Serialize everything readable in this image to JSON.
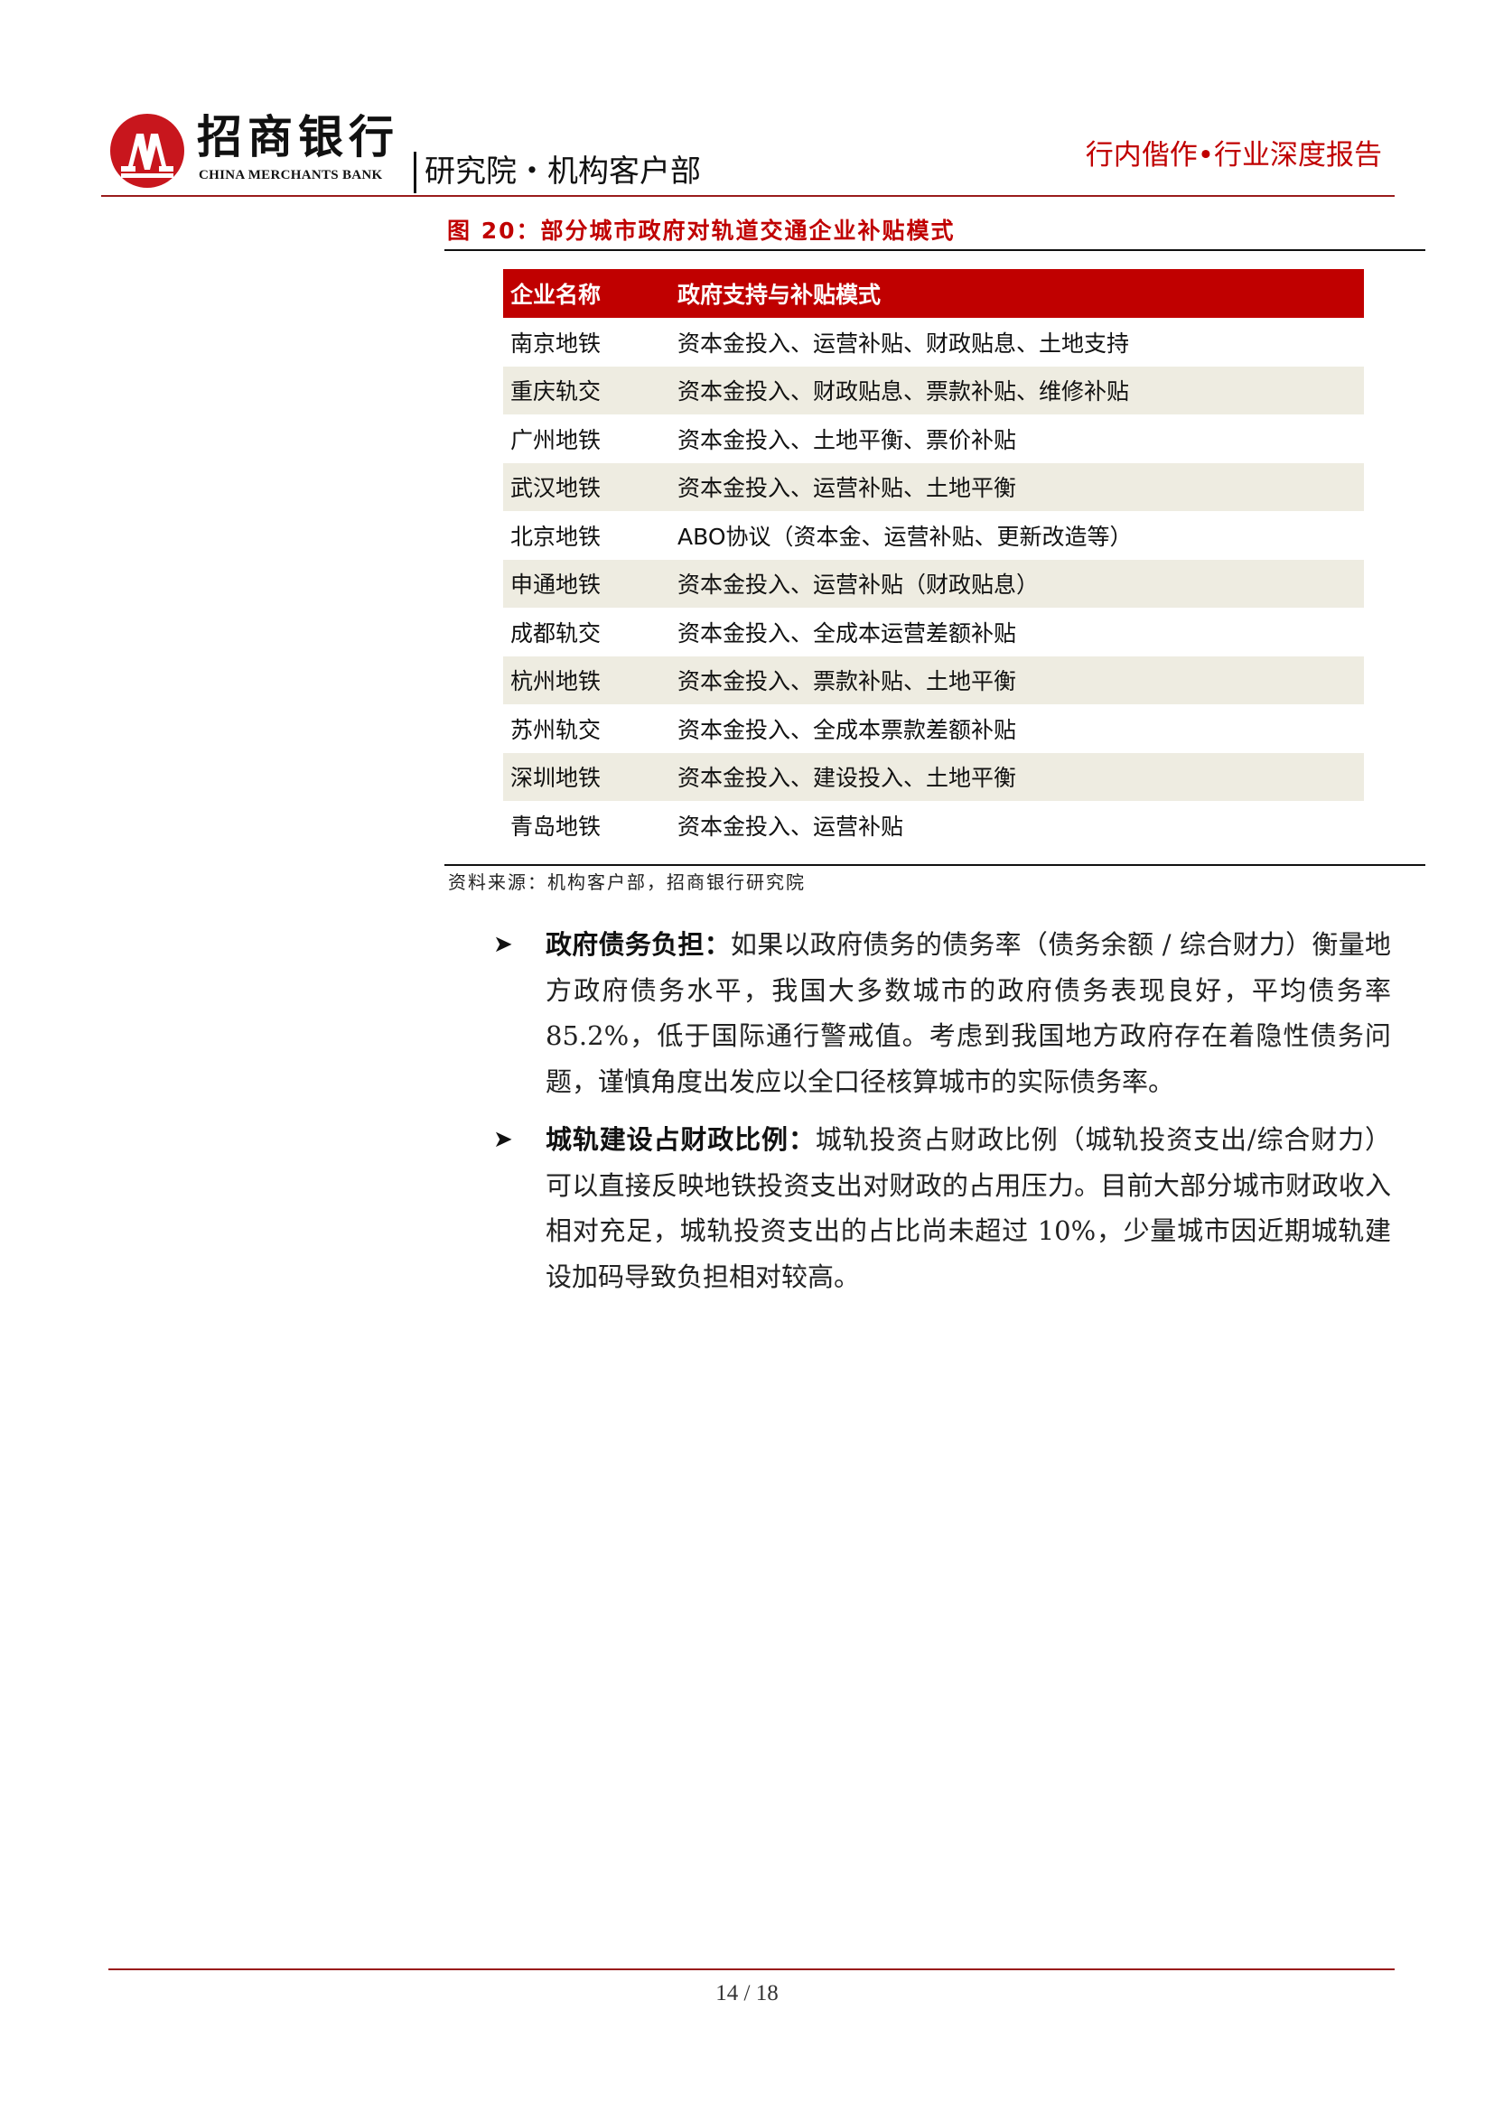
{
  "header": {
    "logo_cn": "招商银行",
    "logo_en": "CHINA MERCHANTS BANK",
    "department": "研究院・机构客户部",
    "report_type": "行内偕作•行业深度报告",
    "brand_color": "#c00000"
  },
  "figure": {
    "title": "图 20：部分城市政府对轨道交通企业补贴模式",
    "columns": [
      "企业名称",
      "政府支持与补贴模式"
    ],
    "rows": [
      [
        "南京地铁",
        "资本金投入、运营补贴、财政贴息、土地支持"
      ],
      [
        "重庆轨交",
        "资本金投入、财政贴息、票款补贴、维修补贴"
      ],
      [
        "广州地铁",
        "资本金投入、土地平衡、票价补贴"
      ],
      [
        "武汉地铁",
        "资本金投入、运营补贴、土地平衡"
      ],
      [
        "北京地铁",
        "ABO协议（资本金、运营补贴、更新改造等）"
      ],
      [
        "申通地铁",
        "资本金投入、运营补贴（财政贴息）"
      ],
      [
        "成都轨交",
        "资本金投入、全成本运营差额补贴"
      ],
      [
        "杭州地铁",
        "资本金投入、票款补贴、土地平衡"
      ],
      [
        "苏州轨交",
        "资本金投入、全成本票款差额补贴"
      ],
      [
        "深圳地铁",
        "资本金投入、建设投入、土地平衡"
      ],
      [
        "青岛地铁",
        "资本金投入、运营补贴"
      ]
    ],
    "header_bg": "#c00000",
    "stripe_bg": "#eeece1",
    "source": "资料来源：机构客户部，招商银行研究院"
  },
  "bullets": [
    {
      "title": "政府债务负担：",
      "text": "如果以政府债务的债务率（债务余额 / 综合财力）衡量地方政府债务水平，我国大多数城市的政府债务表现良好，平均债务率 85.2%，低于国际通行警戒值。考虑到我国地方政府存在着隐性债务问题，谨慎角度出发应以全口径核算城市的实际债务率。"
    },
    {
      "title": "城轨建设占财政比例：",
      "text": "城轨投资占财政比例（城轨投资支出/综合财力）可以直接反映地铁投资支出对财政的占用压力。目前大部分城市财政收入相对充足，城轨投资支出的占比尚未超过 10%，少量城市因近期城轨建设加码导致负担相对较高。"
    }
  ],
  "footer": {
    "page": "14 / 18"
  }
}
